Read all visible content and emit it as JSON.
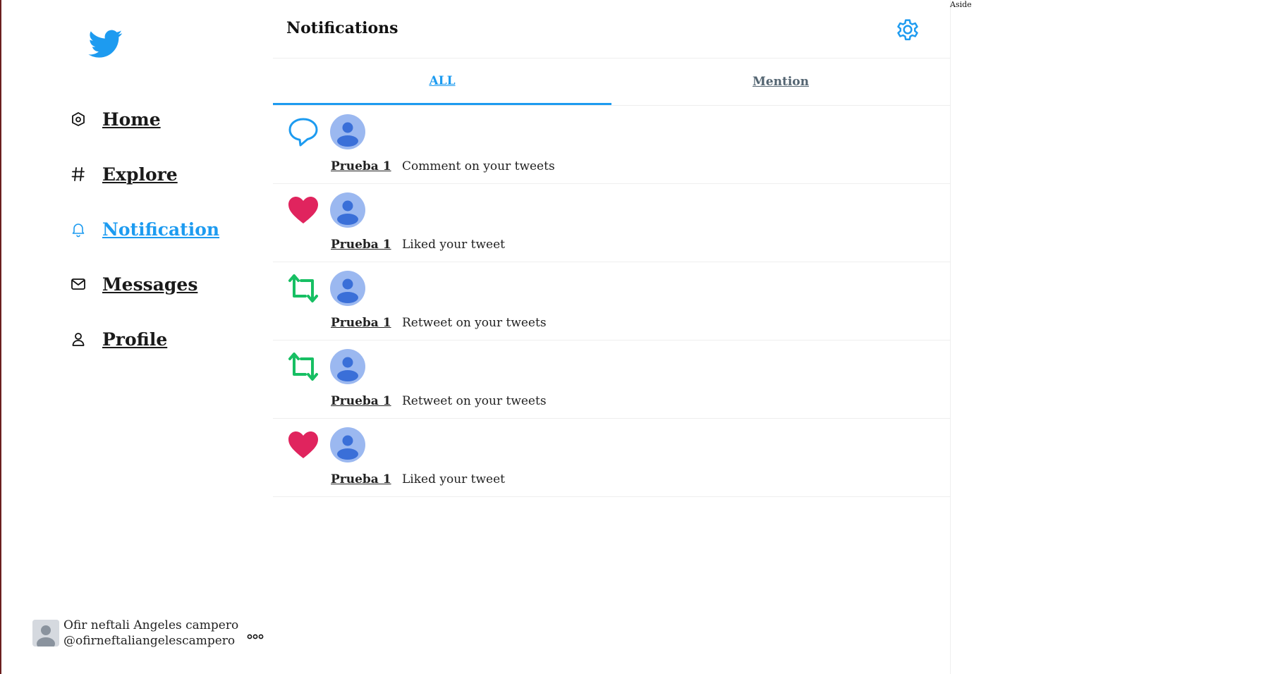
{
  "sidebar": {
    "logo_icon": "twitter-bird-icon",
    "items": [
      {
        "label": "Home",
        "icon": "home-icon"
      },
      {
        "label": "Explore",
        "icon": "hashtag-icon"
      },
      {
        "label": "Notification",
        "icon": "bell-icon",
        "active": true
      },
      {
        "label": "Messages",
        "icon": "mail-icon"
      },
      {
        "label": "Profile",
        "icon": "user-icon"
      }
    ],
    "account": {
      "name": "Ofir neftali Angeles campero",
      "handle": "@ofirneftaliangelescampero",
      "more_icon": "more-icon"
    }
  },
  "header": {
    "title": "Notifications",
    "settings_icon": "gear-icon"
  },
  "tabs": [
    {
      "label": "ALL",
      "active": true
    },
    {
      "label": "Mention",
      "active": false
    }
  ],
  "notifications": [
    {
      "type": "comment",
      "user": "Prueba 1",
      "text": "Comment on your tweets"
    },
    {
      "type": "like",
      "user": "Prueba 1",
      "text": "Liked your tweet"
    },
    {
      "type": "retweet",
      "user": "Prueba 1",
      "text": "Retweet on your tweets"
    },
    {
      "type": "retweet",
      "user": "Prueba 1",
      "text": "Retweet on your tweets"
    },
    {
      "type": "like",
      "user": "Prueba 1",
      "text": "Liked your tweet"
    }
  ],
  "aside": {
    "label": "Aside"
  },
  "colors": {
    "accent": "#1d9bf0",
    "like": "#e0245e",
    "retweet": "#17bf63",
    "avatar_bg": "#9bb8f0",
    "avatar_fg": "#3a6fd8"
  }
}
